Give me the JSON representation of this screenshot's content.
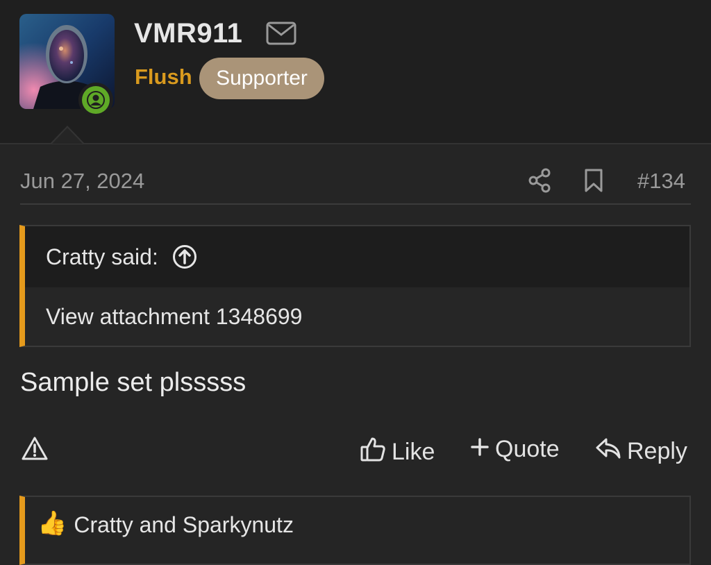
{
  "author": {
    "username": "VMR911",
    "user_title": "Flush",
    "badge": "Supporter",
    "online": true
  },
  "post": {
    "date": "Jun 27, 2024",
    "number": "#134",
    "quote": {
      "attribution": "Cratty said:",
      "content": "View attachment 1348699"
    },
    "body": "Sample set plsssss"
  },
  "actions": {
    "like": "Like",
    "quote": "Quote",
    "reply": "Reply"
  },
  "reactions": {
    "emoji": "👍",
    "summary": "Cratty and Sparkynutz"
  },
  "colors": {
    "background": "#252525",
    "header_bg": "#1f1f1f",
    "accent": "#e59a1c",
    "badge": "#aa9478",
    "online": "#5fa927"
  },
  "icons": [
    "mail-icon",
    "share-icon",
    "bookmark-icon",
    "arrow-up-circle-icon",
    "warning-icon",
    "thumbs-up-icon",
    "plus-icon",
    "reply-icon",
    "user-icon"
  ]
}
